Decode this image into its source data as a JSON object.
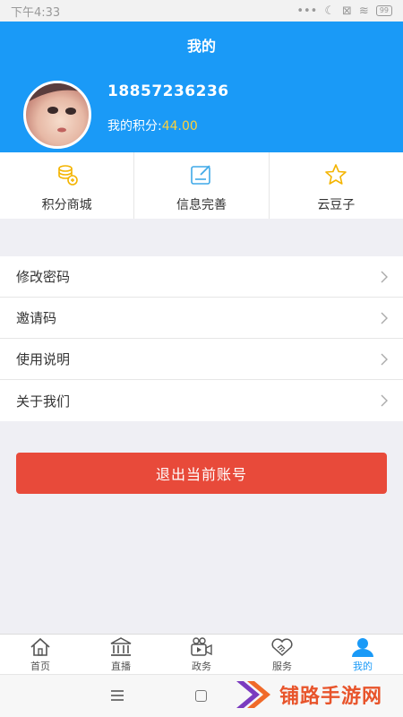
{
  "status_bar": {
    "time": "下午4:33",
    "battery": "99"
  },
  "header": {
    "title": "我的",
    "phone": "18857236236",
    "points_label": "我的积分:",
    "points_value": "44.00",
    "accent_color": "#1a9af7"
  },
  "quick_actions": [
    {
      "label": "积分商城",
      "icon": "coins-icon"
    },
    {
      "label": "信息完善",
      "icon": "edit-info-icon"
    },
    {
      "label": "云豆子",
      "icon": "star-icon"
    }
  ],
  "menu": [
    {
      "label": "修改密码"
    },
    {
      "label": "邀请码"
    },
    {
      "label": "使用说明"
    },
    {
      "label": "关于我们"
    }
  ],
  "logout": {
    "label": "退出当前账号",
    "color": "#e84a3a"
  },
  "tabbar": [
    {
      "label": "首页",
      "icon": "home-icon"
    },
    {
      "label": "直播",
      "icon": "building-icon"
    },
    {
      "label": "政务",
      "icon": "video-camera-icon"
    },
    {
      "label": "服务",
      "icon": "handshake-icon"
    },
    {
      "label": "我的",
      "icon": "user-icon",
      "active": true
    }
  ],
  "watermark": {
    "text": "铺路手游网"
  }
}
